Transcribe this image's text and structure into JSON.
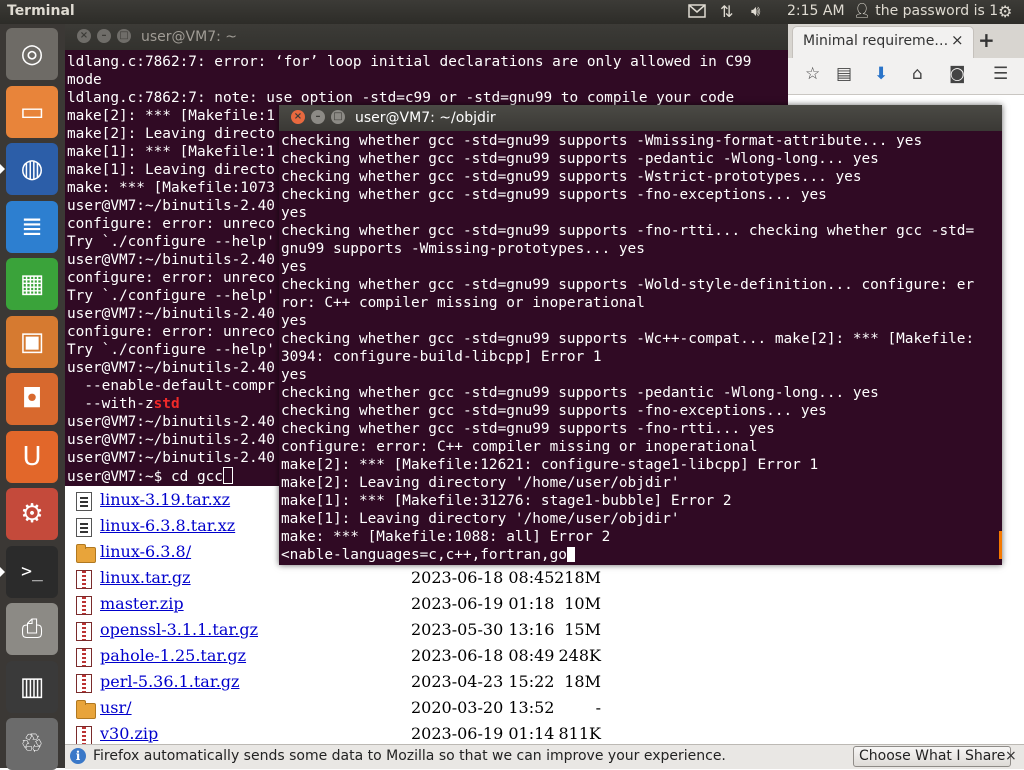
{
  "top_panel": {
    "title": "Terminal",
    "clock": "2:15 AM",
    "user_label": "the password is 1"
  },
  "launcher": {
    "items": [
      {
        "name": "dash",
        "color": "#6e6b66"
      },
      {
        "name": "files",
        "color": "#e8843a"
      },
      {
        "name": "firefox",
        "color": "#2c5ea8"
      },
      {
        "name": "writer",
        "color": "#2d7fd0"
      },
      {
        "name": "calc",
        "color": "#3aa33a"
      },
      {
        "name": "impress",
        "color": "#d67a30"
      },
      {
        "name": "software-center",
        "color": "#d8692e"
      },
      {
        "name": "ubuntu-one",
        "color": "#e2672a"
      },
      {
        "name": "system-settings",
        "color": "#c44a3b"
      },
      {
        "name": "terminal",
        "color": "#2b2b2b"
      },
      {
        "name": "printer",
        "color": "#8c8a85"
      },
      {
        "name": "workspaces",
        "color": "#3a3a3a"
      },
      {
        "name": "trash",
        "color": "#6b6b6b"
      }
    ]
  },
  "browser": {
    "tab_title": "Minimal requireme…",
    "tab_close": "×",
    "new_tab": "+",
    "notification": {
      "text": "Firefox automatically sends some data to Mozilla so that we can improve your experience.",
      "button": "Choose What I Share",
      "close": "×"
    },
    "listing": [
      {
        "icon": "doc",
        "name": "linux-3.19.tar.xz",
        "date": "",
        "size": ""
      },
      {
        "icon": "doc",
        "name": "linux-6.3.8.tar.xz",
        "date": "",
        "size": ""
      },
      {
        "icon": "folder",
        "name": "linux-6.3.8/",
        "date": "",
        "size": ""
      },
      {
        "icon": "archive",
        "name": "linux.tar.gz",
        "date": "2023-06-18 08:45",
        "size": "218M"
      },
      {
        "icon": "archive",
        "name": "master.zip",
        "date": "2023-06-19 01:18",
        "size": "10M"
      },
      {
        "icon": "archive",
        "name": "openssl-3.1.1.tar.gz",
        "date": "2023-05-30 13:16",
        "size": "15M"
      },
      {
        "icon": "archive",
        "name": "pahole-1.25.tar.gz",
        "date": "2023-06-18 08:49",
        "size": "248K"
      },
      {
        "icon": "archive",
        "name": "perl-5.36.1.tar.gz",
        "date": "2023-04-23 15:22",
        "size": "18M"
      },
      {
        "icon": "folder",
        "name": "usr/",
        "date": "2020-03-20 13:52",
        "size": "-"
      },
      {
        "icon": "archive",
        "name": "v30.zip",
        "date": "2023-06-19 01:14",
        "size": "811K"
      }
    ]
  },
  "term_back": {
    "title": "user@VM7: ~",
    "lines": [
      "ldlang.c:7862:7: error: ‘for’ loop initial declarations are only allowed in C99",
      "mode",
      "ldlang.c:7862:7: note: use option -std=c99 or -std=gnu99 to compile your code",
      "make[2]: *** [Makefile:1",
      "make[2]: Leaving directo",
      "make[1]: *** [Makefile:1",
      "make[1]: Leaving directo",
      "make: *** [Makefile:1073",
      "user@VM7:~/binutils-2.40",
      "configure: error: unreco",
      "Try `./configure --help'",
      "user@VM7:~/binutils-2.40",
      "configure: error: unreco",
      "Try `./configure --help'",
      "user@VM7:~/binutils-2.40",
      "configure: error: unreco",
      "Try `./configure --help'",
      "user@VM7:~/binutils-2.40",
      "  --enable-default-compr",
      "  --with-z",
      "user@VM7:~/binutils-2.40",
      "user@VM7:~/binutils-2.40",
      "user@VM7:~/binutils-2.40",
      "user@VM7:~$ cd gcc"
    ],
    "highlight": "std"
  },
  "term_front": {
    "title": "user@VM7: ~/objdir",
    "lines": [
      "checking whether gcc -std=gnu99 supports -Wmissing-format-attribute... yes",
      "checking whether gcc -std=gnu99 supports -pedantic -Wlong-long... yes",
      "checking whether gcc -std=gnu99 supports -Wstrict-prototypes... yes",
      "checking whether gcc -std=gnu99 supports -fno-exceptions... yes",
      "yes",
      "checking whether gcc -std=gnu99 supports -fno-rtti... checking whether gcc -std=",
      "gnu99 supports -Wmissing-prototypes... yes",
      "yes",
      "checking whether gcc -std=gnu99 supports -Wold-style-definition... configure: er",
      "ror: C++ compiler missing or inoperational",
      "yes",
      "checking whether gcc -std=gnu99 supports -Wc++-compat... make[2]: *** [Makefile:",
      "3094: configure-build-libcpp] Error 1",
      "yes",
      "checking whether gcc -std=gnu99 supports -pedantic -Wlong-long... yes",
      "checking whether gcc -std=gnu99 supports -fno-exceptions... yes",
      "checking whether gcc -std=gnu99 supports -fno-rtti... yes",
      "configure: error: C++ compiler missing or inoperational",
      "make[2]: *** [Makefile:12621: configure-stage1-libcpp] Error 1",
      "make[2]: Leaving directory '/home/user/objdir'",
      "make[1]: *** [Makefile:31276: stage1-bubble] Error 2",
      "make[1]: Leaving directory '/home/user/objdir'",
      "make: *** [Makefile:1088: all] Error 2",
      "<nable-languages=c,c++,fortran,go"
    ]
  }
}
